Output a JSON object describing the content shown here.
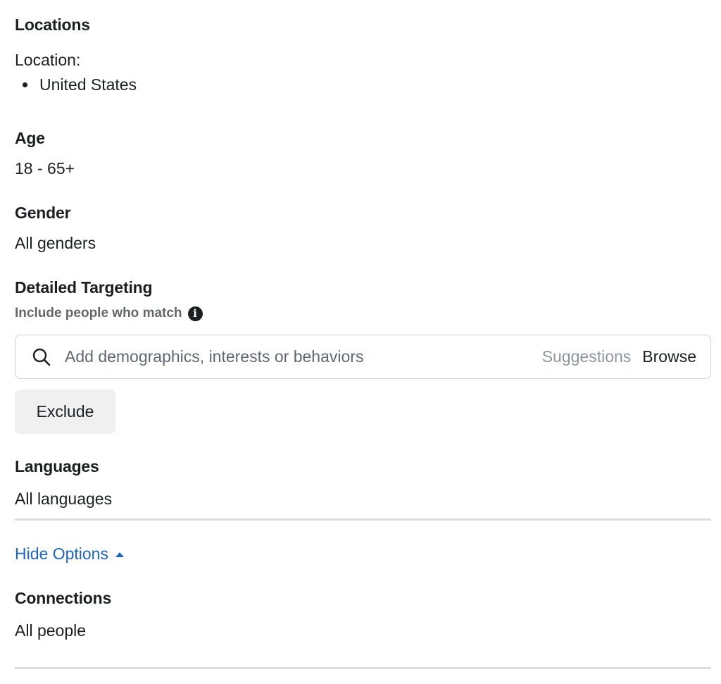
{
  "locations": {
    "heading": "Locations",
    "label": "Location:",
    "items": [
      "United States"
    ]
  },
  "age": {
    "heading": "Age",
    "value": "18 - 65+"
  },
  "gender": {
    "heading": "Gender",
    "value": "All genders"
  },
  "detailed_targeting": {
    "heading": "Detailed Targeting",
    "hint": "Include people who match",
    "info_icon": "i",
    "search": {
      "icon": "search-icon",
      "placeholder": "Add demographics, interests or behaviors",
      "value": "",
      "suggestions_label": "Suggestions",
      "browse_label": "Browse"
    },
    "exclude_label": "Exclude"
  },
  "languages": {
    "heading": "Languages",
    "value": "All languages"
  },
  "hide_options": {
    "label": "Hide Options",
    "icon": "caret-up-icon"
  },
  "connections": {
    "heading": "Connections",
    "value": "All people"
  },
  "colors": {
    "link": "#1d65c1",
    "text": "#1c1e21",
    "muted": "#65676b",
    "divider": "#dadde1",
    "button_bg": "#f0f0f0"
  }
}
